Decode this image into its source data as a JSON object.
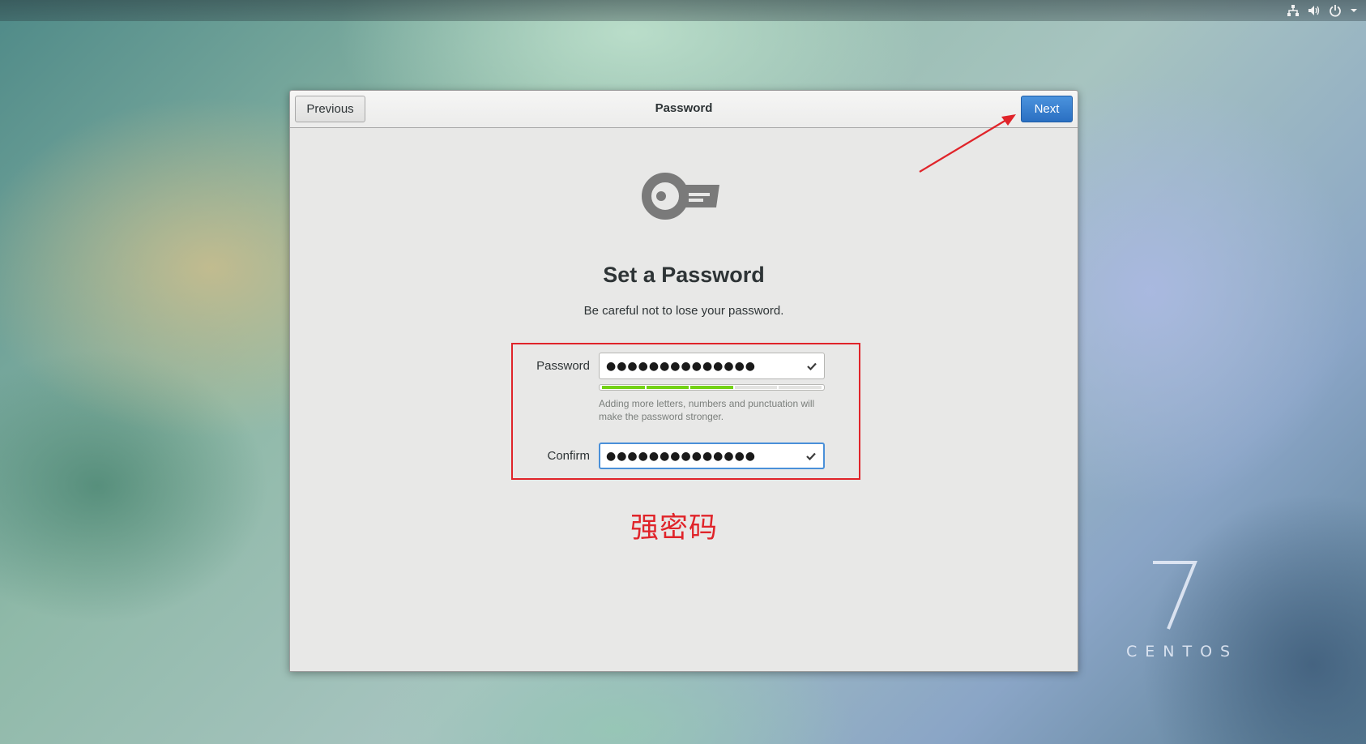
{
  "topbar": {
    "icons": [
      "network-icon",
      "volume-icon",
      "power-icon",
      "chevron-down-icon"
    ]
  },
  "dialog": {
    "header": {
      "title": "Password",
      "previous_label": "Previous",
      "next_label": "Next"
    },
    "icon": "key-icon",
    "heading": "Set a Password",
    "subtitle": "Be careful not to lose your password.",
    "password": {
      "label": "Password",
      "value_masked": "●●●●●●●●●●●●●●",
      "valid": true
    },
    "strength": {
      "level_fraction": 0.6,
      "segments_total": 5,
      "segments_filled": 3,
      "color": "#73d216",
      "hint": "Adding more letters, numbers and punctuation will make the password stronger."
    },
    "confirm": {
      "label": "Confirm",
      "value_masked": "●●●●●●●●●●●●●●",
      "valid": true,
      "focused": true
    }
  },
  "annotation": {
    "text": "强密码",
    "color": "#e0242a"
  },
  "branding": {
    "version": "7",
    "name": "CENTOS"
  },
  "colors": {
    "accent": "#4a90d9",
    "next_button": "#2a6fc2"
  }
}
